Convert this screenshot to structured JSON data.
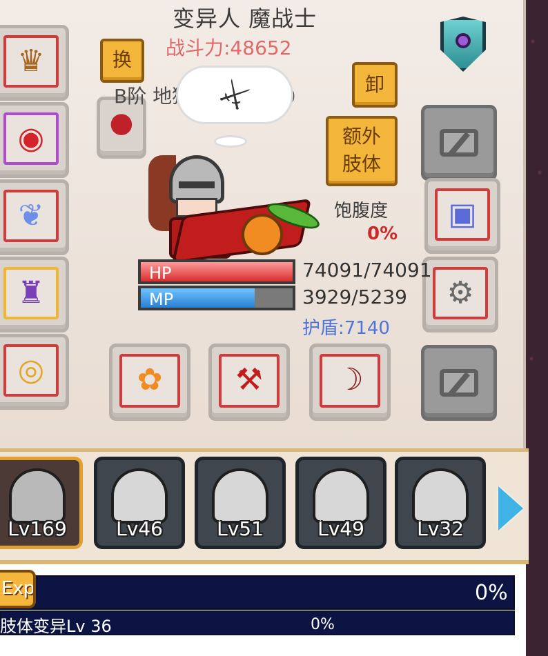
{
  "header": {
    "title": "变异人 魔战士",
    "combat_power": "战斗力:48652",
    "weapon_name": "B阶 地狱使徒: Lv 60"
  },
  "buttons": {
    "swap_label": "换",
    "unequip_label": "卸",
    "extra_limb_label_line1": "额外",
    "extra_limb_label_line2": "肢体"
  },
  "stats": {
    "hp_label": "HP",
    "hp_text": "74091/74091",
    "hp_fraction": 1.0,
    "mp_label": "MP",
    "mp_text": "3929/5239",
    "mp_fraction": 0.75,
    "shield_text": "护盾:7140",
    "satiety_label": "饱腹度",
    "satiety_value": "0%"
  },
  "equipment": {
    "left_slots": [
      {
        "icon": "thorn-crown-icon"
      },
      {
        "icon": "pendant-amulet-icon"
      },
      {
        "icon": "blue-wing-icon"
      },
      {
        "icon": "purple-armor-icon"
      },
      {
        "icon": "golden-ring-icon"
      }
    ],
    "inner_slot": {
      "icon": "red-orb-icon"
    },
    "bottom_slots": [
      {
        "icon": "pumpkin-staff-icon"
      },
      {
        "icon": "red-scythe-icon"
      },
      {
        "icon": "demon-bow-icon"
      }
    ],
    "right_slots": [
      {
        "icon": "locked-slot-icon"
      },
      {
        "icon": "device-icon"
      },
      {
        "icon": "mech-gun-icon"
      },
      {
        "icon": "locked-slot-icon"
      }
    ]
  },
  "roster": {
    "characters": [
      {
        "level": "Lv169",
        "selected": true
      },
      {
        "level": "Lv46",
        "selected": false
      },
      {
        "level": "Lv51",
        "selected": false
      },
      {
        "level": "Lv49",
        "selected": false
      },
      {
        "level": "Lv32",
        "selected": false
      }
    ]
  },
  "progress": {
    "exp_label": "Exp",
    "exp_value": "0%",
    "mutation_label": "肢体变异Lv 36",
    "mutation_value": "0%"
  },
  "colors": {
    "accent_gold": "#f3b63a",
    "hp_red": "#d72d2d",
    "mp_blue": "#2a7fd3",
    "shield_blue": "#4f74d8",
    "satiety_red": "#cc2a2a"
  }
}
